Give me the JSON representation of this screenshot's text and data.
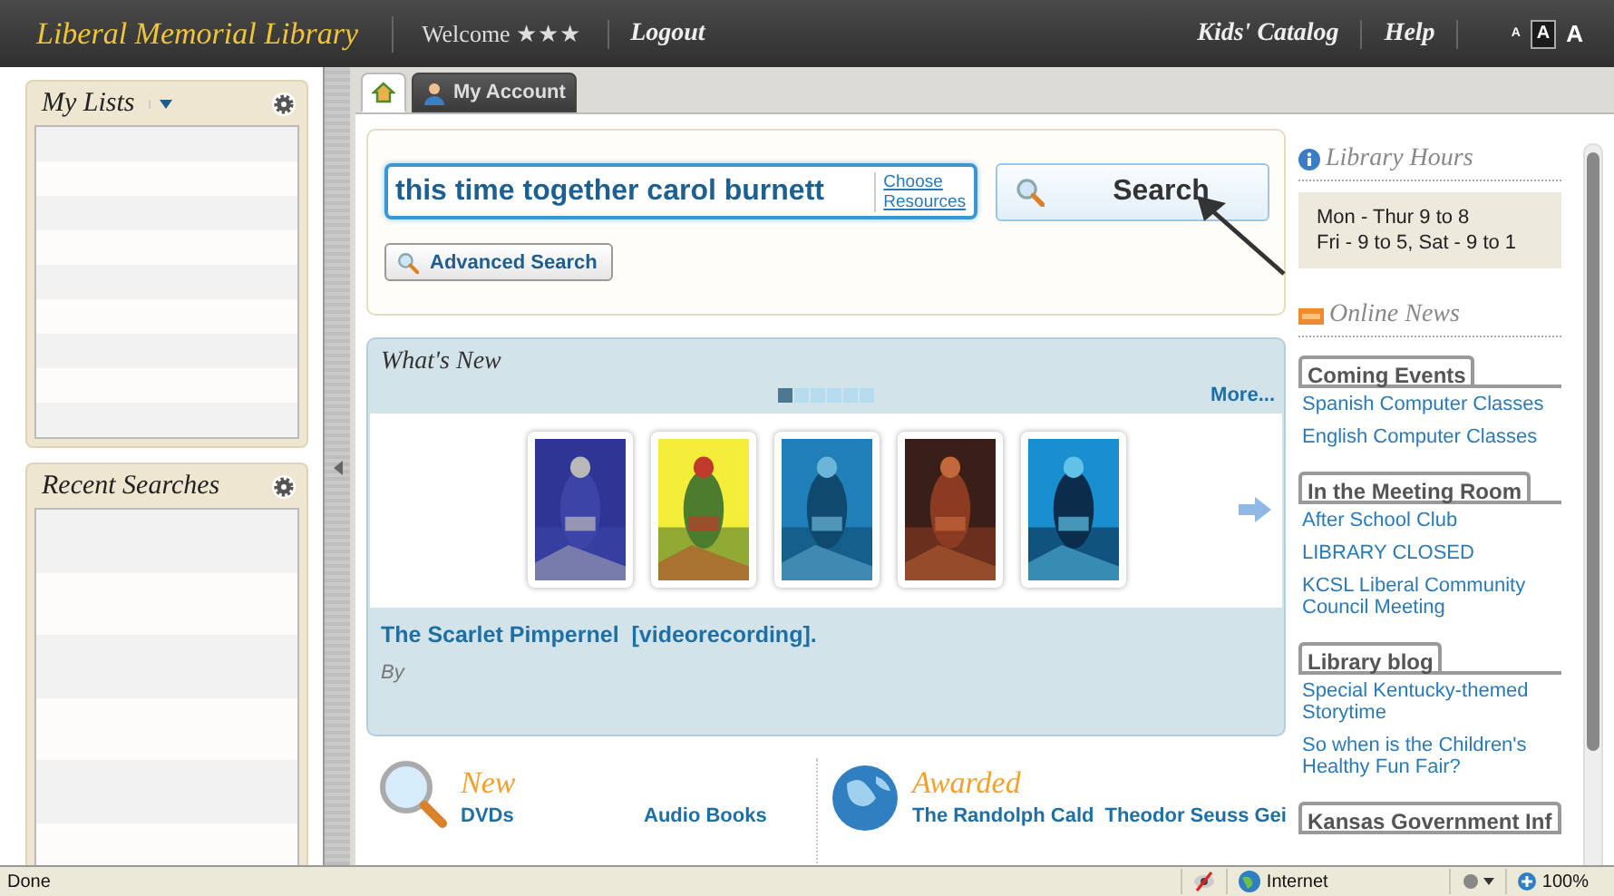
{
  "header": {
    "title": "Liberal Memorial Library",
    "welcome": "Welcome ★★★",
    "logout": "Logout",
    "links": [
      "Kids' Catalog",
      "Help"
    ],
    "font_sizes": [
      {
        "label": "A",
        "selected": false
      },
      {
        "label": "A",
        "selected": true
      },
      {
        "label": "A",
        "selected": false
      }
    ]
  },
  "sidebar": {
    "panels": [
      {
        "kind": "lists",
        "title": "My Lists"
      },
      {
        "kind": "recent",
        "title": "Recent Searches"
      }
    ]
  },
  "tabs": [
    {
      "kind": "home",
      "selected": true
    },
    {
      "kind": "account",
      "label": "My Account",
      "selected": false
    }
  ],
  "search": {
    "value": "this time together carol burnett",
    "choose": [
      "Choose",
      "Resources"
    ],
    "button": "Search",
    "advanced": "Advanced Search"
  },
  "whats_new": {
    "title": "What's New",
    "more": "More...",
    "pages": [
      {
        "selected": true
      },
      {
        "selected": false
      },
      {
        "selected": false
      },
      {
        "selected": false
      },
      {
        "selected": false
      },
      {
        "selected": false
      }
    ],
    "item_title": "The Scarlet Pimpernel  [videorecording].",
    "item_by": "By"
  },
  "bottom": {
    "sections": [
      {
        "kind": "new",
        "title": "New",
        "links": [
          "DVDs",
          "Audio Books"
        ]
      },
      {
        "kind": "awarded",
        "title": "Awarded",
        "links": [
          "The Randolph Cald",
          "Theodor Seuss Gei"
        ]
      }
    ]
  },
  "right": {
    "hours_title": "Library Hours",
    "hours": [
      "Mon - Thur 9 to 8",
      "Fri - 9 to 5, Sat - 9 to 1"
    ],
    "news_title": "Online News",
    "groups": [
      {
        "title": "Coming Events",
        "links": [
          "Spanish Computer Classes",
          "English Computer Classes"
        ]
      },
      {
        "title": "In the Meeting Room",
        "links": [
          "After School Club",
          "LIBRARY CLOSED",
          "KCSL Liberal Community Council Meeting"
        ]
      },
      {
        "title": "Library blog",
        "links": [
          "Special Kentucky-themed Storytime",
          "So when is the Children's Healthy Fun Fair?"
        ]
      },
      {
        "title": "Kansas Government Inf"
      }
    ]
  },
  "status_bar": {
    "text": "Done",
    "zone": "Internet",
    "zoom": "100%"
  }
}
